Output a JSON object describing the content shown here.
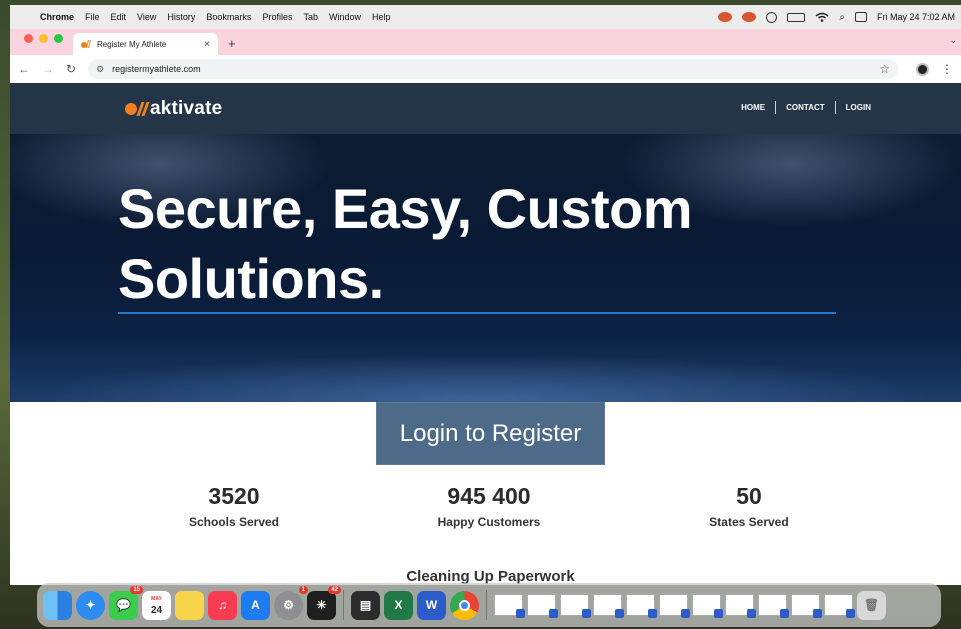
{
  "menubar": {
    "app": "Chrome",
    "items": [
      "File",
      "Edit",
      "View",
      "History",
      "Bookmarks",
      "Profiles",
      "Tab",
      "Window",
      "Help"
    ],
    "clock": "Fri May 24  7:02 AM"
  },
  "browser": {
    "tab_title": "Register My Athlete",
    "url": "registermyathlete.com",
    "new_tab": "+",
    "tab_close": "×"
  },
  "site": {
    "logo_text": "aktivate",
    "nav": [
      "HOME",
      "CONTACT",
      "LOGIN"
    ],
    "hero_title": "Secure, Easy, Custom Solutions.",
    "cta": "Login to Register",
    "stats": [
      {
        "value": "3520",
        "label": "Schools Served"
      },
      {
        "value": "945 400",
        "label": "Happy Customers"
      },
      {
        "value": "50",
        "label": "States Served"
      }
    ],
    "next_section": "Cleaning Up Paperwork"
  },
  "dock": {
    "calendar_month": "MAY",
    "calendar_day": "24",
    "badges": {
      "messages": "15",
      "settings": "1",
      "perplexity": "42"
    }
  },
  "colors": {
    "nav_bg": "#233546",
    "accent_orange": "#f07f1d",
    "cta_bg": "#4d6b88",
    "hero_rule": "#2a79c8",
    "tabstrip": "#f9d4de"
  }
}
